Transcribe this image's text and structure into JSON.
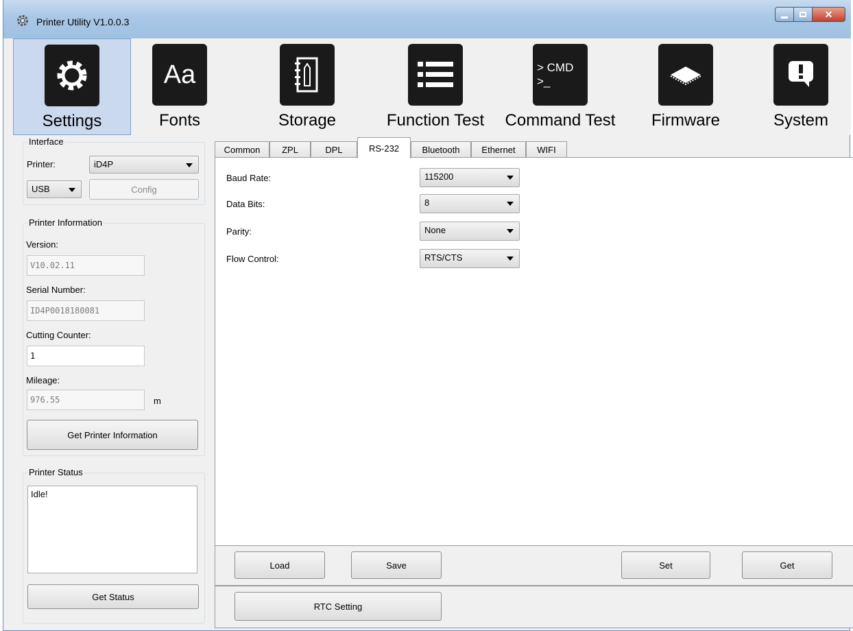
{
  "window": {
    "title": "Printer Utility  V1.0.0.3"
  },
  "toolbar": {
    "items": [
      {
        "label": "Settings",
        "icon": "gear-icon",
        "active": true
      },
      {
        "label": "Fonts",
        "icon": "font-icon",
        "glyph": "Aa"
      },
      {
        "label": "Storage",
        "icon": "notebook-icon"
      },
      {
        "label": "Function Test",
        "icon": "list-icon"
      },
      {
        "label": "Command Test",
        "icon": "cmd-icon",
        "glyph": "> CMD\n>_"
      },
      {
        "label": "Firmware",
        "icon": "chip-icon"
      },
      {
        "label": "System",
        "icon": "alert-icon"
      }
    ]
  },
  "interface": {
    "title": "Interface",
    "printer_label": "Printer:",
    "printer_value": "iD4P",
    "port_value": "USB",
    "config_label": "Config"
  },
  "printer_info": {
    "title": "Printer Information",
    "version_label": "Version:",
    "version_value": "V10.02.11",
    "serial_label": "Serial Number:",
    "serial_value": "ID4P0018180081",
    "cutting_label": "Cutting Counter:",
    "cutting_value": "1",
    "mileage_label": "Mileage:",
    "mileage_value": "976.55",
    "mileage_unit": "m",
    "get_button": "Get Printer Information"
  },
  "printer_status": {
    "title": "Printer Status",
    "text": "Idle!",
    "get_button": "Get Status"
  },
  "tabs": [
    "Common",
    "ZPL",
    "DPL",
    "RS-232",
    "Bluetooth",
    "Ethernet",
    "WIFI"
  ],
  "active_tab": "RS-232",
  "rs232": {
    "baud_label": "Baud Rate:",
    "baud_value": "115200",
    "databits_label": "Data Bits:",
    "databits_value": "8",
    "parity_label": "Parity:",
    "parity_value": "None",
    "flow_label": "Flow Control:",
    "flow_value": "RTS/CTS"
  },
  "actions": {
    "load": "Load",
    "save": "Save",
    "set": "Set",
    "get": "Get",
    "rtc": "RTC Setting"
  }
}
